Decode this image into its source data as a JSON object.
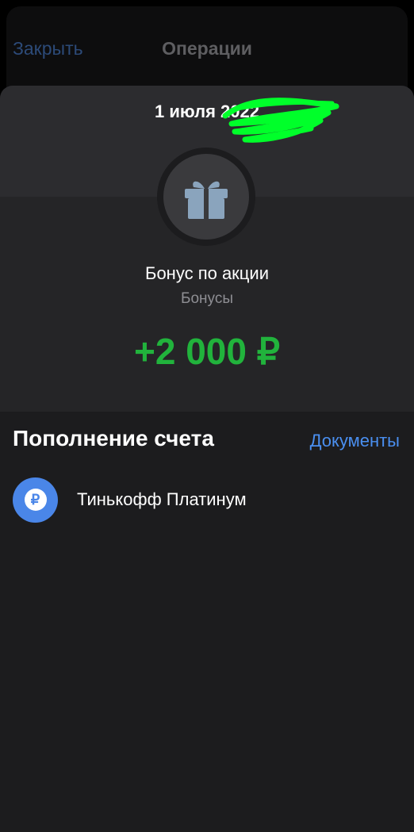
{
  "header": {
    "close_label": "Закрыть",
    "title": "Операции"
  },
  "operation": {
    "date": "1 июля 2022",
    "icon": "gift-icon",
    "title": "Бонус по акции",
    "category": "Бонусы",
    "amount": "+2 000 ₽"
  },
  "details": {
    "section_title": "Пополнение счета",
    "documents_label": "Документы",
    "account": {
      "icon": "ruble-icon",
      "icon_glyph": "₽",
      "name": "Тинькофф Платинум"
    }
  },
  "colors": {
    "amount": "#21b33c",
    "link": "#4a8ff0",
    "account_icon": "#4a86e8",
    "redaction": "#00ff2a"
  }
}
